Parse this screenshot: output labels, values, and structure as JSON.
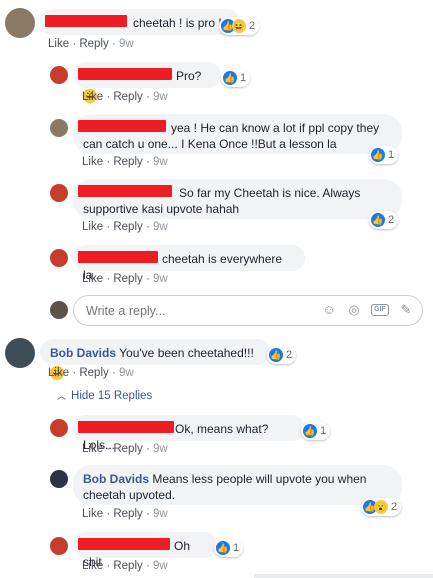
{
  "actions": {
    "like": "Like",
    "reply": "Reply",
    "dot": "·"
  },
  "comments": [
    {
      "text": "cheetah ! is pro !!",
      "time": "9w",
      "reactions": "2"
    },
    {
      "text": "Pro?",
      "time": "9w",
      "reactions": "1"
    },
    {
      "text": "yea ! He can know a lot if ppl copy they can catch u one... I Kena Once !!But a lesson la",
      "time": "9w",
      "reactions": "1"
    },
    {
      "text": "So far my Cheetah is nice. Always supportive kasi upvote hahah",
      "time": "9w",
      "reactions": "2"
    },
    {
      "text": "cheetah is everywhere la..",
      "time": "9w"
    },
    {
      "name": "Bob Davids",
      "text": "You've been cheetahed!!!",
      "time": "9w",
      "reactions": "2"
    },
    {
      "text": "Ok, means what? Lols...",
      "time": "9w",
      "reactions": "1"
    },
    {
      "name": "Bob Davids",
      "text": "Means less people will upvote you when cheetah upvoted.",
      "time": "9w",
      "reactions": "2"
    },
    {
      "text": "Oh shit",
      "time": "9w",
      "reactions": "1"
    }
  ],
  "reply_box": {
    "placeholder": "Write a reply..."
  },
  "hide_replies": "Hide 15 Replies",
  "colors": {
    "bubble": "#f2f3f5",
    "name": "#385898",
    "redaction": "#ee1d23",
    "like": "#1877f2"
  }
}
